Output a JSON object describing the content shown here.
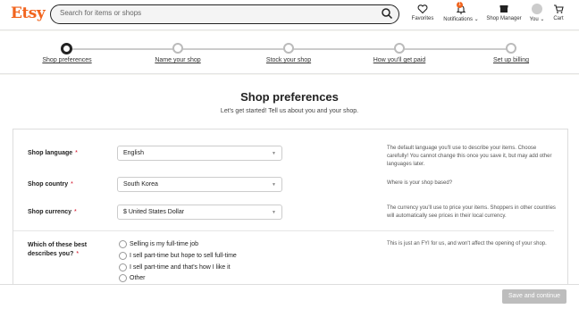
{
  "header": {
    "logo": "Etsy",
    "search_placeholder": "Search for items or shops",
    "nav": [
      {
        "label": "Favorites"
      },
      {
        "label": "Notifications",
        "badge": "1"
      },
      {
        "label": "Shop Manager"
      },
      {
        "label": "You"
      },
      {
        "label": "Cart"
      }
    ]
  },
  "progress": {
    "steps": [
      {
        "label": "Shop preferences",
        "active": true
      },
      {
        "label": "Name your shop"
      },
      {
        "label": "Stock your shop"
      },
      {
        "label": "How you'll get paid"
      },
      {
        "label": "Set up billing"
      }
    ]
  },
  "main": {
    "title": "Shop preferences",
    "subtitle": "Let's get started! Tell us about you and your shop.",
    "language": {
      "label": "Shop language",
      "required_mark": "*",
      "value": "English",
      "help": "The default language you'll use to describe your items. Choose carefully! You cannot change this once you save it, but may add other languages later."
    },
    "country": {
      "label": "Shop country",
      "required_mark": "*",
      "value": "South Korea",
      "help": "Where is your shop based?"
    },
    "currency": {
      "label": "Shop currency",
      "required_mark": "*",
      "value": "$ United States Dollar",
      "help": "The currency you'll use to price your items. Shoppers in other countries will automatically see prices in their local currency."
    },
    "describe": {
      "label_line1": "Which of these best",
      "label_line2": "describes you?",
      "required_mark": "*",
      "options": [
        "Selling is my full-time job",
        "I sell part-time but hope to sell full-time",
        "I sell part-time and that's how I like it",
        "Other"
      ],
      "help": "This is just an FYI for us, and won't affect the opening of your shop."
    }
  },
  "footer": {
    "save_label": "Save and continue"
  },
  "colors": {
    "brand": "#f1641e",
    "button_disabled": "#bdbdbd"
  }
}
